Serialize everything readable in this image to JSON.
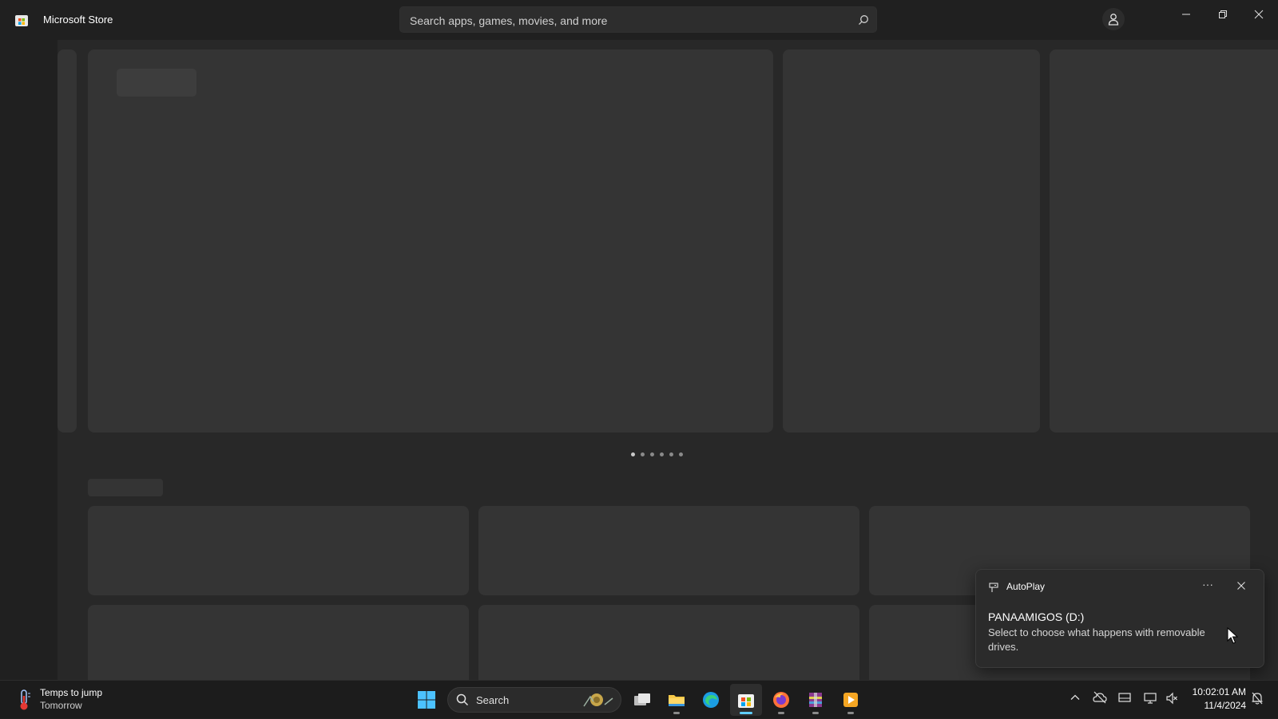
{
  "window": {
    "title": "Microsoft Store",
    "search": {
      "placeholder": "Search apps, games, movies, and more"
    }
  },
  "carousel": {
    "page_count": 6,
    "active_page": 1
  },
  "notification": {
    "app_name": "AutoPlay",
    "more_label": "···",
    "title": "PANAAMIGOS (D:)",
    "body": "Select to choose what happens with removable drives."
  },
  "taskbar": {
    "weather": {
      "title": "Temps to jump",
      "subtitle": "Tomorrow"
    },
    "search_label": "Search",
    "clock": {
      "time": "10:02:01 AM",
      "date": "11/4/2024"
    }
  },
  "colors": {
    "background": "#202020",
    "content": "#282828",
    "skeleton": "#343434",
    "accent": "#60cdff"
  }
}
